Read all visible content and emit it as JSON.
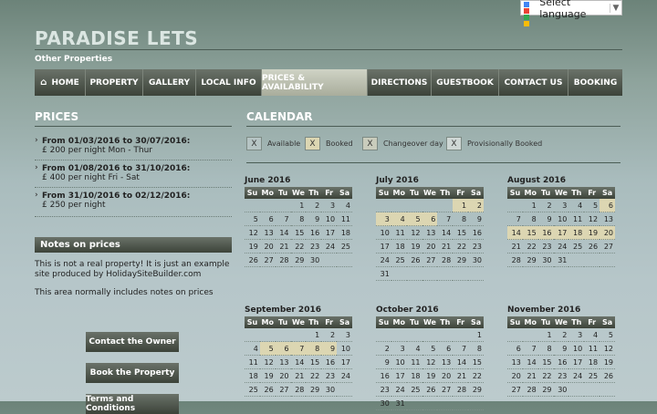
{
  "lang": {
    "label": "Select language",
    "arrow": "▼"
  },
  "site": {
    "title": "PARADISE LETS",
    "subtitle": "Other Properties"
  },
  "nav": [
    "HOME",
    "PROPERTY",
    "GALLERY",
    "LOCAL INFO",
    "PRICES & AVAILABILITY",
    "DIRECTIONS",
    "GUESTBOOK",
    "CONTACT US",
    "BOOKING"
  ],
  "nav_active": "PRICES & AVAILABILITY",
  "prices": {
    "title": "PRICES",
    "items": [
      {
        "range": "From 01/03/2016 to 30/07/2016:",
        "rate": "£ 200 per night Mon - Thur"
      },
      {
        "range": "From 01/08/2016 to 31/10/2016:",
        "rate": "£ 400 per night Fri - Sat"
      },
      {
        "range": "From 31/10/2016 to 02/12/2016:",
        "rate": "£ 250 per night"
      }
    ]
  },
  "notes": {
    "title": "Notes on prices",
    "p1": "This is not a real property! It is just an example site produced by HolidaySiteBuilder.com",
    "p2": "This area normally includes notes on prices"
  },
  "buttons": {
    "contact": "Contact the Owner",
    "book": "Book the Property",
    "terms": "Terms and Conditions"
  },
  "calendar": {
    "title": "CALENDAR",
    "legend": [
      {
        "mark": "X",
        "label": "Available",
        "color": "#b6c4c4"
      },
      {
        "mark": "X",
        "label": "Booked",
        "color": "#dcd6b2"
      },
      {
        "mark": "X",
        "label": "Changeover day",
        "color": "#c9ccbc"
      },
      {
        "mark": "X",
        "label": "Provisionally Booked",
        "color": "#cfd7d5"
      }
    ],
    "days": [
      "Su",
      "Mo",
      "Tu",
      "We",
      "Th",
      "Fr",
      "Sa"
    ],
    "booked_color": "#dcd6b2",
    "months": [
      {
        "name": "June 2016",
        "start": 3,
        "len": 30,
        "booked": []
      },
      {
        "name": "July 2016",
        "start": 5,
        "len": 31,
        "booked": [
          1,
          2,
          3,
          4,
          5,
          6
        ]
      },
      {
        "name": "August 2016",
        "start": 1,
        "len": 31,
        "booked": [
          6,
          14,
          15,
          16,
          17,
          18,
          19,
          20
        ]
      },
      {
        "name": "September 2016",
        "start": 4,
        "len": 30,
        "booked": [
          5,
          6,
          7,
          8,
          9
        ]
      },
      {
        "name": "October 2016",
        "start": 6,
        "len": 31,
        "booked": []
      },
      {
        "name": "November 2016",
        "start": 2,
        "len": 30,
        "booked": []
      }
    ]
  }
}
